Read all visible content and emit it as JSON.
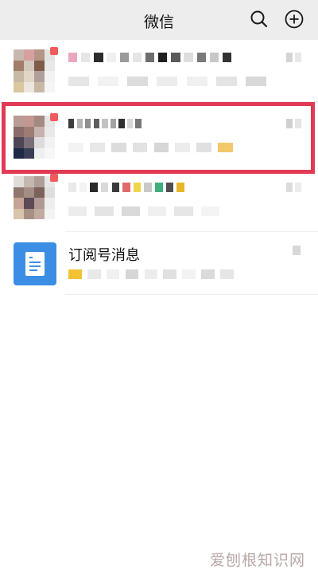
{
  "header": {
    "title": "微信",
    "search_icon": "search-icon",
    "add_icon": "plus-circle-icon"
  },
  "chats": [
    {
      "avatar_colors": [
        "#c8b8b0",
        "#d6a0a0",
        "#b59486",
        "#e5e2dd",
        "#a27d69",
        "#d2c8be",
        "#7e5c4a",
        "#e8e8e8",
        "#c7b9a4",
        "#e2d7c6",
        "#b0a09a",
        "#f2f2f2",
        "#d9c79e",
        "#ece6dc",
        "#c9b8a6",
        "#f5f5f5"
      ],
      "badge": true,
      "name_blur": [
        "#e9a7c1",
        "#e6e6e6",
        "#2d2d2d",
        "#f0f0f0",
        "#9b9b9b",
        "#e5e5e5",
        "#6e6e6e",
        "#1f1f1f",
        "#5a5a5a",
        "#dedede",
        "#7a7a7a",
        "#c8c8c8",
        "#333333"
      ],
      "preview_blur": [
        "#e6e6e6",
        "#f2f2f2",
        "#dcdcdc",
        "#ededed",
        "#f0f0f0",
        "#e4e4e4",
        "#d9d9d9"
      ],
      "time_blur": [
        "#d4d4d4",
        "#e8e8e8"
      ]
    },
    {
      "avatar_colors": [
        "#b89c95",
        "#c29791",
        "#a38a80",
        "#e6e4e4",
        "#8a6c6a",
        "#9e7c73",
        "#c7b1ac",
        "#e9e9e9",
        "#4e4656",
        "#7a6f78",
        "#dcdcdc",
        "#f2f2f2",
        "#1e2a45",
        "#3b3d55",
        "#efefef",
        "#f7f7f7"
      ],
      "badge": true,
      "name_blur": [
        "#3c3c3c",
        "#b3b3b3",
        "#8f8f8f",
        "#5e5e5e",
        "#c2c2c2",
        "#a3a3a3",
        "#2e2e2e",
        "#d6d6d6",
        "#777777"
      ],
      "preview_blur": [
        "#f3f3f3",
        "#e8e8e8",
        "#dcdcdc",
        "#e2e2e2",
        "#d6d6d6",
        "#ececec",
        "#e0e0e0",
        "#f2c86a"
      ],
      "time_blur": [
        "#d0d0d0",
        "#e4e4e4"
      ]
    },
    {
      "avatar_colors": [
        "#e1dcd8",
        "#c5b8b1",
        "#b09d97",
        "#e8e6e6",
        "#8f7770",
        "#a38d86",
        "#7c625a",
        "#dedede",
        "#c5a493",
        "#5c4a56",
        "#b09992",
        "#eeeeee",
        "#d8c3ab",
        "#a68f84",
        "#c2aaa0",
        "#f3f3f3"
      ],
      "badge": true,
      "name_blur": [
        "#e9e9e9",
        "#f3f3f3",
        "#2b2b2b",
        "#d9d9d9",
        "#3a3a3a",
        "#e16b6b",
        "#f2d64a",
        "#c9c9c9",
        "#3fb07b",
        "#4f4f4f",
        "#e8b62c"
      ],
      "preview_blur": [
        "#ececec",
        "#e4e4e4",
        "#dadada",
        "#f0f0f0",
        "#e6e6e6",
        "#f4f4f4"
      ],
      "time_blur": [
        "#dcdcdc",
        "#ececec"
      ]
    }
  ],
  "subscription": {
    "name": "订阅号消息",
    "avatar_color": "#3b8ee3",
    "icon": "document-icon",
    "preview_blur": [
      "#f3c232",
      "#e8e8e8",
      "#f0f0f0",
      "#d6d6d6",
      "#ececec",
      "#e0e0e0",
      "#f2f2f2",
      "#dadada",
      "#e6e6e6"
    ],
    "time_blur": [
      "#d8d8d8"
    ]
  },
  "watermark": "爱刨根知识网",
  "highlight_color": "#e03a55"
}
